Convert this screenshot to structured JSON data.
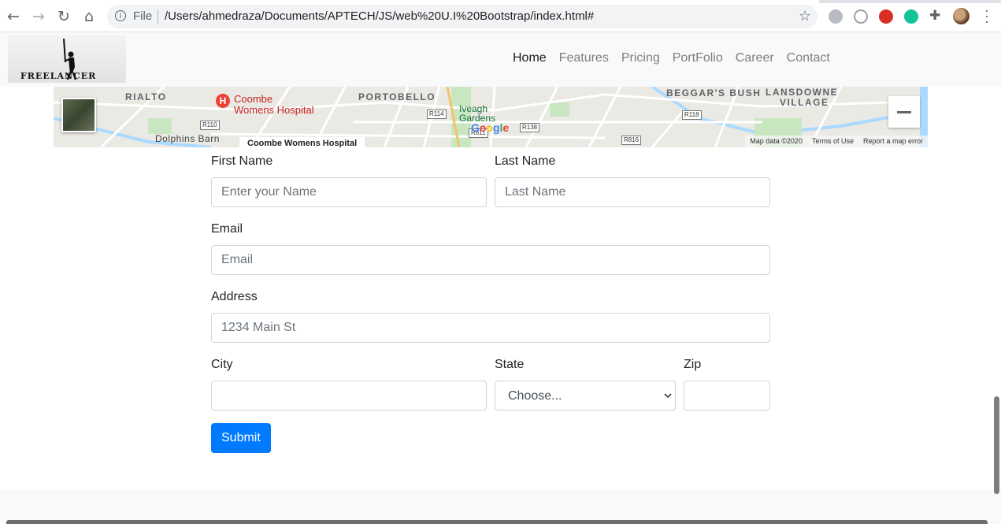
{
  "browser": {
    "file_label": "File",
    "url": "/Users/ahmedraza/Documents/APTECH/JS/web%20U.I%20Bootstrap/index.html#",
    "icons": [
      "back-icon",
      "forward-icon",
      "reload-icon",
      "home-icon",
      "info-icon",
      "star-icon",
      "extension-icon",
      "puzzle-icon",
      "avatar",
      "menu-icon"
    ]
  },
  "navbar": {
    "brand": "FREELANCER",
    "links": [
      {
        "label": "Home",
        "active": true
      },
      {
        "label": "Features"
      },
      {
        "label": "Pricing"
      },
      {
        "label": "PortFolio"
      },
      {
        "label": "Career"
      },
      {
        "label": "Contact"
      }
    ]
  },
  "map": {
    "labels": {
      "rialto": "RIALTO",
      "portobello": "PORTOBELLO",
      "beggars_bush": "BEGGAR'S BUSH",
      "lansdowne": "LANSDOWNE",
      "village": "VILLAGE",
      "dolphins_barn": "Dolphins Barn",
      "hospital_line1": "Coombe",
      "hospital_line2": "Womens Hospital",
      "iveagh_line1": "Iveagh",
      "iveagh_line2": "Gardens"
    },
    "roads": [
      "R110",
      "R114",
      "R138",
      "R118",
      "R816",
      "R811",
      "R110"
    ],
    "tooltip": "Coombe Womens Hospital",
    "google": "Google",
    "footer": [
      "Map data ©2020",
      "Terms of Use",
      "Report a map error"
    ],
    "zoom_out_label": "−",
    "colors": {
      "park": "#c8e6c0",
      "water": "#aadaff",
      "road": "#ffffff"
    }
  },
  "form": {
    "first_name_label": "First Name",
    "first_name_placeholder": "Enter your Name",
    "last_name_label": "Last Name",
    "last_name_placeholder": "Last Name",
    "email_label": "Email",
    "email_placeholder": "Email",
    "address_label": "Address",
    "address_placeholder": "1234 Main St",
    "city_label": "City",
    "city_value": "",
    "state_label": "State",
    "state_selected": "Choose...",
    "zip_label": "Zip",
    "zip_value": "",
    "submit_label": "Submit",
    "primary_color": "#007bff"
  }
}
